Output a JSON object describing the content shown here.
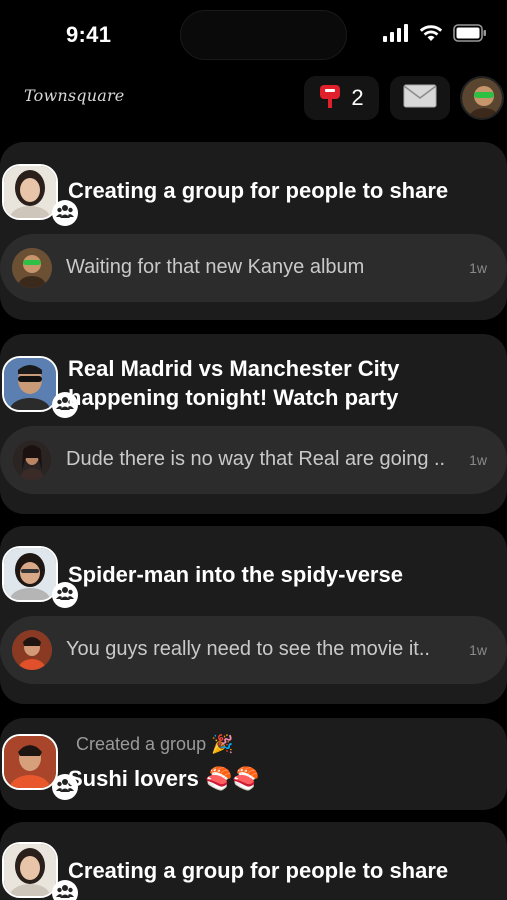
{
  "status_bar": {
    "time": "9:41"
  },
  "header": {
    "brand": "Townsquare",
    "notification_count": "2"
  },
  "feed": [
    {
      "title": "Creating a group for people to share",
      "reply": {
        "text": "Waiting for that new Kanye album",
        "time": "1w"
      }
    },
    {
      "title": "Real Madrid vs Manchester City happening tonight! Watch party",
      "reply": {
        "text": "Dude there is no way that Real are going ..",
        "time": "1w"
      }
    },
    {
      "title": "Spider-man into the spidy-verse",
      "reply": {
        "text": "You guys really need to see the movie it..",
        "time": "1w"
      }
    },
    {
      "label": "Created a group 🎉",
      "title": "Sushi lovers 🍣🍣"
    },
    {
      "title": "Creating a group for people to share"
    }
  ],
  "colors": {
    "background": "#000000",
    "card": "#1c1c1c",
    "reply_bubble": "#2c2c2c",
    "notification_red": "#e0202a"
  }
}
